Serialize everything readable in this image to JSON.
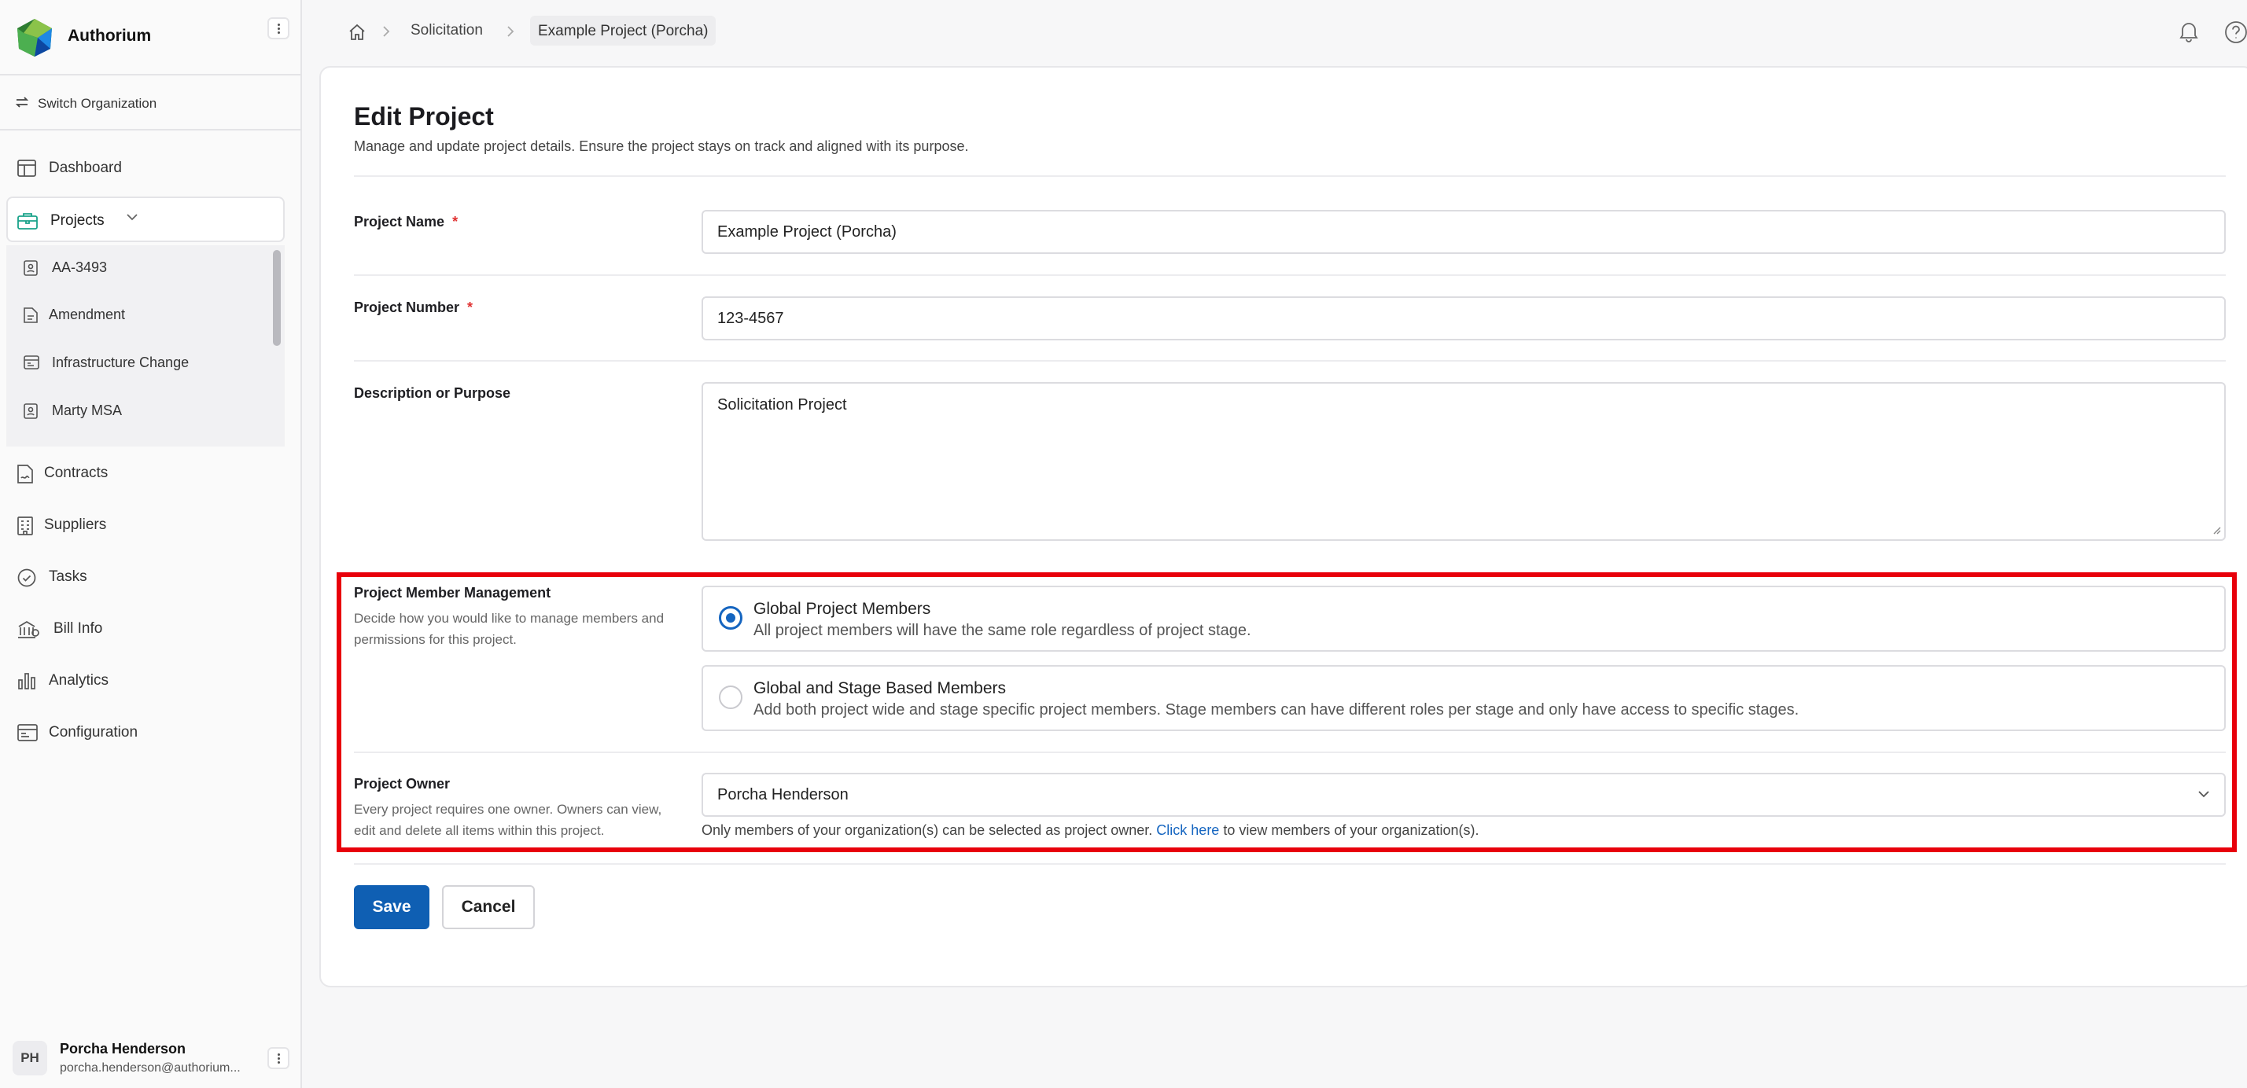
{
  "app": {
    "name": "Authorium"
  },
  "sidebar": {
    "switch_org": "Switch Organization",
    "items": {
      "dashboard": "Dashboard",
      "projects": "Projects",
      "contracts": "Contracts",
      "suppliers": "Suppliers",
      "tasks": "Tasks",
      "bill_info": "Bill Info",
      "analytics": "Analytics",
      "configuration": "Configuration"
    },
    "projects_sub": [
      "AA-3493",
      "Amendment",
      "Infrastructure Change",
      "Marty MSA"
    ],
    "user": {
      "initials": "PH",
      "name": "Porcha Henderson",
      "email": "porcha.henderson@authorium..."
    }
  },
  "breadcrumb": {
    "level1": "Solicitation",
    "current": "Example Project (Porcha)"
  },
  "form": {
    "title": "Edit Project",
    "subtitle": "Manage and update project details. Ensure the project stays on track and aligned with its purpose.",
    "project_name": {
      "label": "Project Name",
      "required": "*",
      "value": "Example Project (Porcha)"
    },
    "project_number": {
      "label": "Project Number",
      "required": "*",
      "value": "123-4567"
    },
    "description": {
      "label": "Description or Purpose",
      "value": "Solicitation Project"
    },
    "member_management": {
      "label": "Project Member Management",
      "help": "Decide how you would like to manage members and permissions for this project.",
      "options": [
        {
          "title": "Global Project Members",
          "desc": "All project members will have the same role regardless of project stage.",
          "selected": true
        },
        {
          "title": "Global and Stage Based Members",
          "desc": "Add both project wide and stage specific project members. Stage members can have different roles per stage and only have access to specific stages.",
          "selected": false
        }
      ]
    },
    "owner": {
      "label": "Project Owner",
      "help": "Every project requires one owner. Owners can view, edit and delete all items within this project.",
      "value": "Porcha Henderson",
      "note_before": "Only members of your organization(s) can be selected as project owner.",
      "note_link": "Click here",
      "note_after": "to view members of your organization(s)."
    },
    "save": "Save",
    "cancel": "Cancel"
  },
  "colors": {
    "primary": "#0f5fb3",
    "highlight": "#e8000b",
    "required": "#e03131"
  }
}
